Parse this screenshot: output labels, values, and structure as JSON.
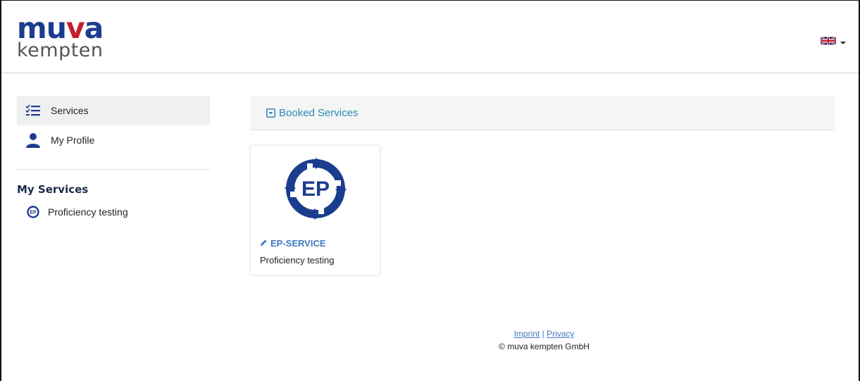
{
  "brand": {
    "line1_a": "mu",
    "line1_b": "v",
    "line1_c": "a",
    "line2": "kempten"
  },
  "header": {
    "language": "English",
    "flag_icon": "uk-flag-icon"
  },
  "sidebar": {
    "nav": [
      {
        "label": "Services",
        "icon": "checklist-icon"
      },
      {
        "label": "My Profile",
        "icon": "user-icon"
      }
    ],
    "section_title": "My Services",
    "services": [
      {
        "label": "Proficiency testing",
        "icon": "ep-logo-icon"
      }
    ]
  },
  "main": {
    "panel_title": "Booked Services",
    "cards": [
      {
        "code": "EP-SERVICE",
        "description": "Proficiency testing",
        "logo_text": "EP"
      }
    ]
  },
  "footer": {
    "imprint": "Imprint",
    "separator": "|",
    "privacy": "Privacy",
    "copyright": "© muva kempten GmbH"
  },
  "colors": {
    "brand_blue": "#1b3d8f",
    "brand_red": "#c51f2c",
    "link": "#3f7bbf",
    "panel_title": "#2a8ab8"
  }
}
